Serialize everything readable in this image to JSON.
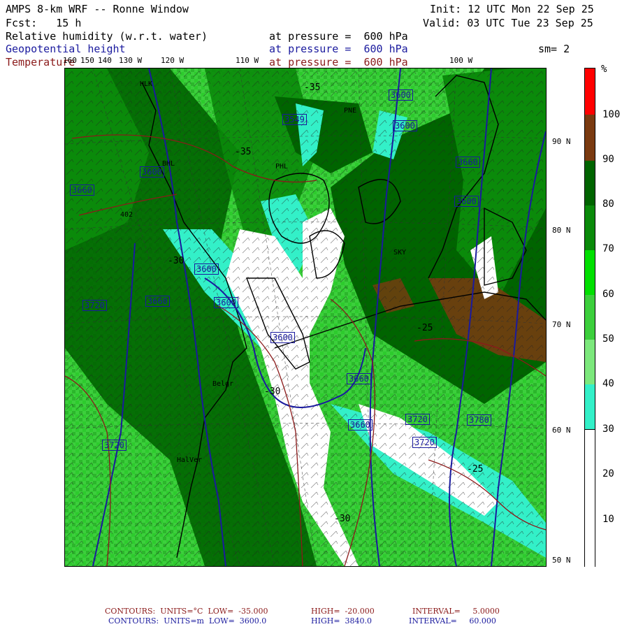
{
  "header": {
    "title": "AMPS 8-km WRF -- Ronne Window",
    "forecast": "Fcst:   15 h",
    "init": "Init: 12 UTC Mon 22 Sep 25",
    "valid": "Valid: 03 UTC Tue 23 Sep 25",
    "fields": [
      {
        "name": "Relative humidity (w.r.t. water)",
        "level": "at pressure =  600 hPa",
        "color": "#000000"
      },
      {
        "name": "Geopotential height",
        "level": "at pressure =  600 hPa",
        "color": "#1a1a9e"
      },
      {
        "name": "Temperature",
        "level": "at pressure =  600 hPa",
        "color": "#8b1a1a"
      }
    ],
    "smoothing": "sm= 2"
  },
  "lon_labels": [
    "160",
    "150",
    "140",
    "130 W",
    "120 W",
    "110 W",
    "100 W"
  ],
  "lat_labels": [
    "90 N",
    "80 N",
    "70 N",
    "60 N",
    "50 N"
  ],
  "colorbar": {
    "unit": "%",
    "labels": [
      "100",
      "90",
      "80",
      "70",
      "60",
      "50",
      "40",
      "30",
      "20",
      "10"
    ],
    "colors": [
      "#ff0000",
      "#7a3a10",
      "#006400",
      "#0a8a0a",
      "#00e000",
      "#3ccf3c",
      "#7ce87c",
      "#33f0c8",
      "#ffffff",
      "#ffffff"
    ]
  },
  "stations": [
    "HLK",
    "PNE",
    "BHL",
    "PHL",
    "402",
    "SKY",
    "Belgr",
    "HalVer"
  ],
  "height_labels": [
    "3600",
    "3660",
    "3720",
    "3780",
    "3549"
  ],
  "temp_labels": [
    "-35",
    "-30",
    "-25"
  ],
  "footer": {
    "line1": {
      "label": "CONTOURS:  UNITS=°C  LOW=  -35.000",
      "high": "HIGH=  -20.000",
      "interval": "INTERVAL=     5.0000"
    },
    "line2": {
      "label": "CONTOURS:  UNITS=m  LOW=  3600.0",
      "high": "HIGH=  3840.0",
      "interval": "INTERVAL=     60.000"
    }
  }
}
